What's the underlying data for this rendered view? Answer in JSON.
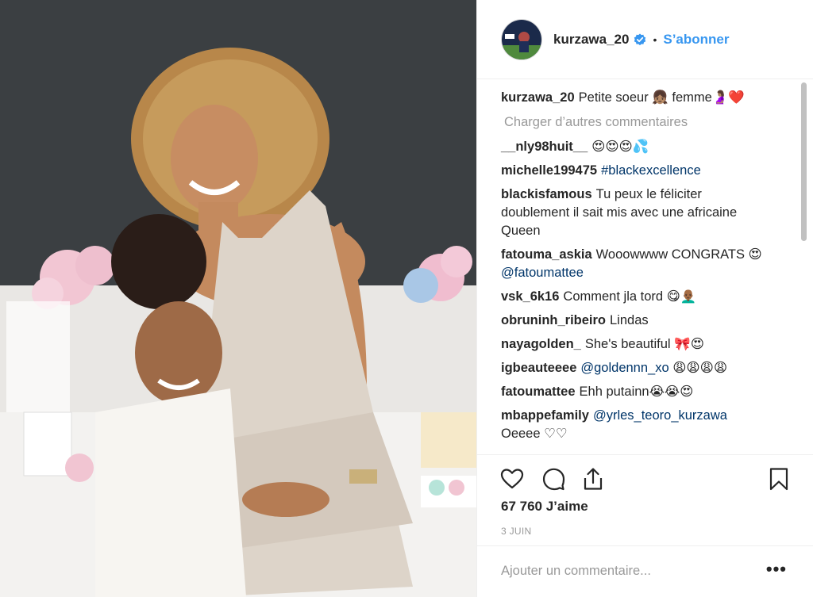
{
  "post": {
    "username": "kurzawa_20",
    "verified": true,
    "separator": "•",
    "follow_label": "S’abonner",
    "caption": {
      "user": "kurzawa_20",
      "text": "Petite soeur 👧🏽 femme🤰🏽❤️"
    },
    "load_more_label": "Charger d’autres commentaires",
    "comments": [
      {
        "user": "__nly98huit__",
        "text": "😍😍😍💦"
      },
      {
        "user": "michelle199475",
        "mention": "#blackexcellence",
        "text": ""
      },
      {
        "user": "blackisfamous",
        "text": "Tu peux le féliciter doublement il sait mis avec une africaine Queen"
      },
      {
        "user": "fatouma_askia",
        "text": "Wooowwww CONGRATS 😍",
        "mention": "@fatoumattee"
      },
      {
        "user": "vsk_6k16",
        "text": "Comment jla tord 😋👨🏾‍🦲"
      },
      {
        "user": "obruninh_ribeiro",
        "text": "Lindas"
      },
      {
        "user": "nayagolden_",
        "text": "She's beautiful 🎀😍"
      },
      {
        "user": "igbeauteeee",
        "mention": "@goldennn_xo",
        "text": "😩😩😩😩"
      },
      {
        "user": "fatoumattee",
        "text": "Ehh putainn😭😭😍"
      },
      {
        "user": "mbappefamily",
        "mention": "@yrles_teoro_kurzawa",
        "text": "Oeeee ♡♡"
      }
    ],
    "likes": "67 760 J’aime",
    "date": "3 JUIN",
    "add_comment_placeholder": "Ajouter un commentaire...",
    "more_label": "•••",
    "icons": [
      "heart-icon",
      "comment-icon",
      "share-icon",
      "bookmark-icon"
    ],
    "colors": {
      "link": "#3897f0",
      "mention": "#003569",
      "muted": "#999999",
      "text": "#262626"
    }
  }
}
